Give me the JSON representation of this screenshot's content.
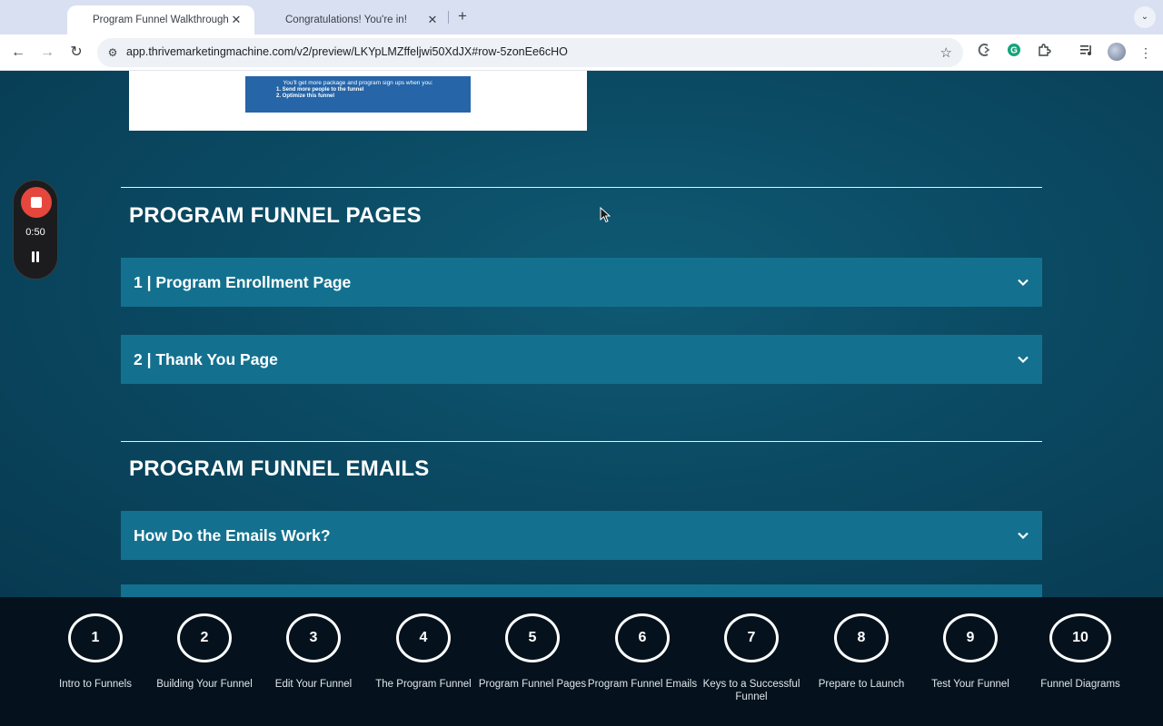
{
  "browser": {
    "tabs": [
      {
        "title": "Program Funnel Walkthrough",
        "active": true
      },
      {
        "title": "Congratulations! You're in!",
        "active": false
      }
    ],
    "url": "app.thrivemarketingmachine.com/v2/preview/LKYpLMZffeljwi50XdJX#row-5zonEe6cHO"
  },
  "preview_image": {
    "heading": "You'll get more package and program sign ups when you:",
    "items": [
      "1. Send more people to the funnel",
      "2. Optimize this funnel"
    ]
  },
  "sections": {
    "pages": {
      "title": "PROGRAM FUNNEL PAGES",
      "accordions": [
        "1 | Program Enrollment Page",
        "2 | Thank You Page"
      ]
    },
    "emails": {
      "title": "PROGRAM FUNNEL EMAILS",
      "accordions": [
        "How Do the Emails Work?"
      ]
    }
  },
  "recorder": {
    "time": "0:50",
    "stop_color": "#e5473c"
  },
  "steps": [
    {
      "number": "1",
      "label": "Intro to Funnels"
    },
    {
      "number": "2",
      "label": "Building Your Funnel"
    },
    {
      "number": "3",
      "label": "Edit Your Funnel"
    },
    {
      "number": "4",
      "label": "The Program Funnel"
    },
    {
      "number": "5",
      "label": "Program Funnel Pages"
    },
    {
      "number": "6",
      "label": "Program Funnel Emails"
    },
    {
      "number": "7",
      "label": "Keys to a Successful Funnel"
    },
    {
      "number": "8",
      "label": "Prepare to Launch"
    },
    {
      "number": "9",
      "label": "Test Your Funnel"
    },
    {
      "number": "10",
      "label": "Funnel Diagrams"
    }
  ],
  "colors": {
    "accordion": "#13718f",
    "background": "#0b4a63",
    "bottom_nav": "#05121d"
  }
}
